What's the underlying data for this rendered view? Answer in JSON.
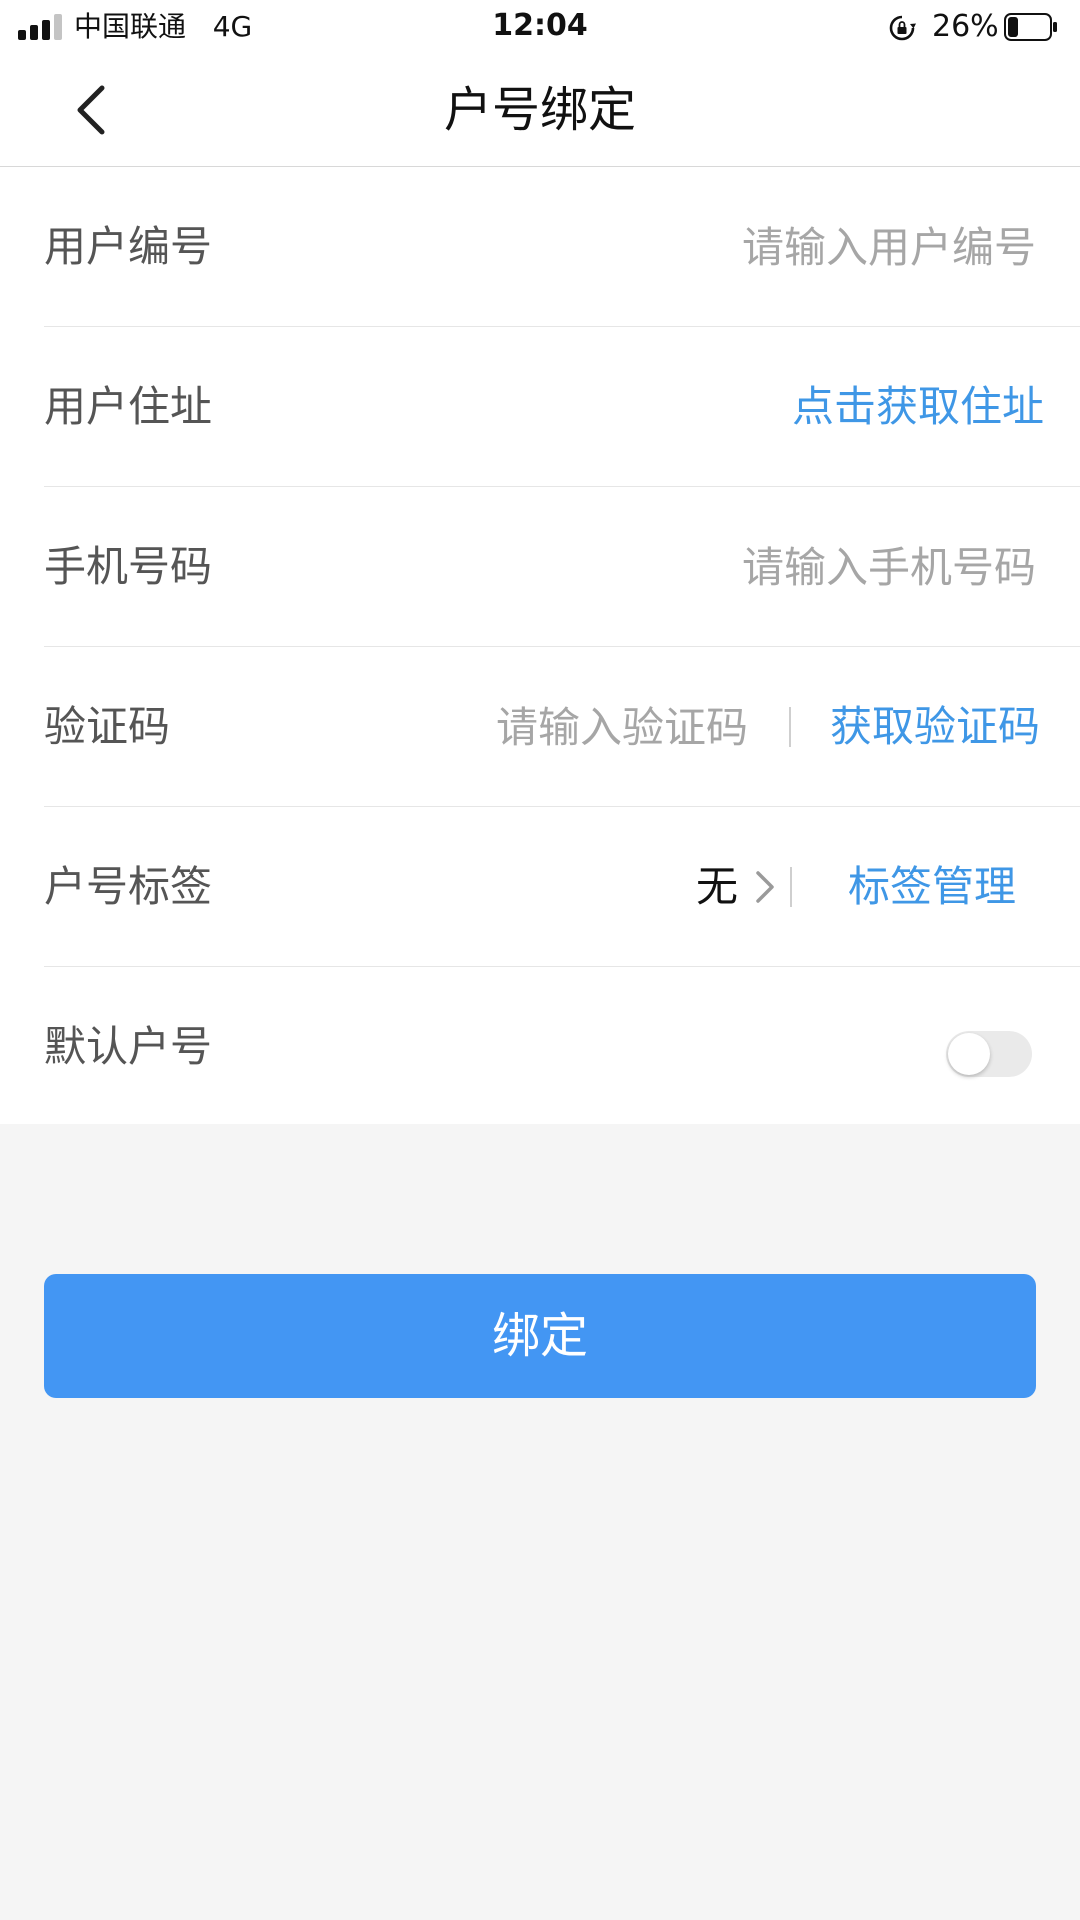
{
  "status_bar": {
    "carrier": "中国联通",
    "network": "4G",
    "time": "12:04",
    "battery_percent": "26%",
    "battery_level": 0.26
  },
  "nav": {
    "title": "户号绑定"
  },
  "form": {
    "user_id": {
      "label": "用户编号",
      "placeholder": "请输入用户编号"
    },
    "address": {
      "label": "用户住址",
      "action": "点击获取住址"
    },
    "phone": {
      "label": "手机号码",
      "placeholder": "请输入手机号码"
    },
    "verification": {
      "label": "验证码",
      "placeholder": "请输入验证码",
      "action": "获取验证码"
    },
    "tag": {
      "label": "户号标签",
      "value": "无",
      "action": "标签管理"
    },
    "default_account": {
      "label": "默认户号",
      "enabled": false
    }
  },
  "bind_button": {
    "label": "绑定"
  },
  "colors": {
    "accent": "#4396f3",
    "link": "#3f97e6",
    "background": "#f5f5f5"
  }
}
